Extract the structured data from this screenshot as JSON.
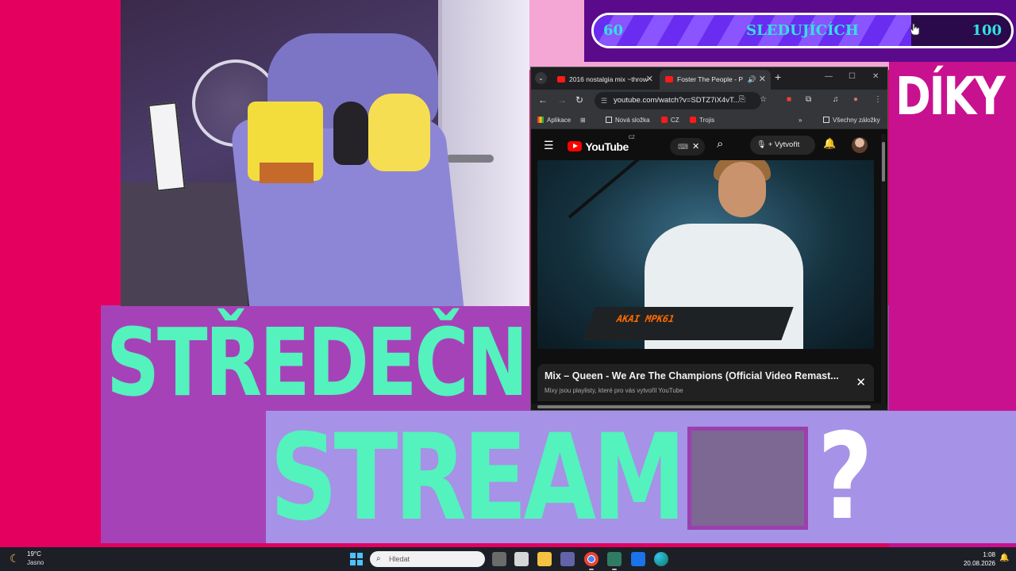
{
  "overlay": {
    "thanks_text": "DÍKY",
    "title_line1": "STŘEDEČNÍ",
    "title_line2": "STREAM",
    "question_mark": "?"
  },
  "follower_goal": {
    "min": "60",
    "label": "SLEDUJÍCÍCH",
    "max": "100",
    "progress_fraction": 0.76
  },
  "browser": {
    "tabs": [
      {
        "label": "2016 nostalgia mix ~throw",
        "active": false
      },
      {
        "label": "Foster The People - P",
        "active": true
      }
    ],
    "url": "youtube.com/watch?v=SDTZ7iX4vT...",
    "bookmarks": [
      "Aplikace",
      "Nová složka",
      "CZ",
      "Trojis"
    ],
    "all_bookmarks": "Všechny záložky",
    "youtube": {
      "logo_text": "YouTube",
      "region": "CZ",
      "create_label": "Vytvořit",
      "video_overlay_brand": "AKAI MPK61",
      "mix_title": "Mix – Queen - We Are The Champions (Official Video Remast...",
      "mix_subtitle": "Mixy jsou playlisty, které pro vás vytvořil YouTube"
    }
  },
  "taskbar": {
    "temperature": "19°C",
    "condition": "Jasno",
    "search_placeholder": "Hledat",
    "time": "1:08",
    "date": "20.08.2026"
  },
  "colors": {
    "accent_mint": "#54f2bd",
    "magenta": "#e3005e",
    "purple": "#a642b8",
    "lavender": "#a692e6"
  }
}
